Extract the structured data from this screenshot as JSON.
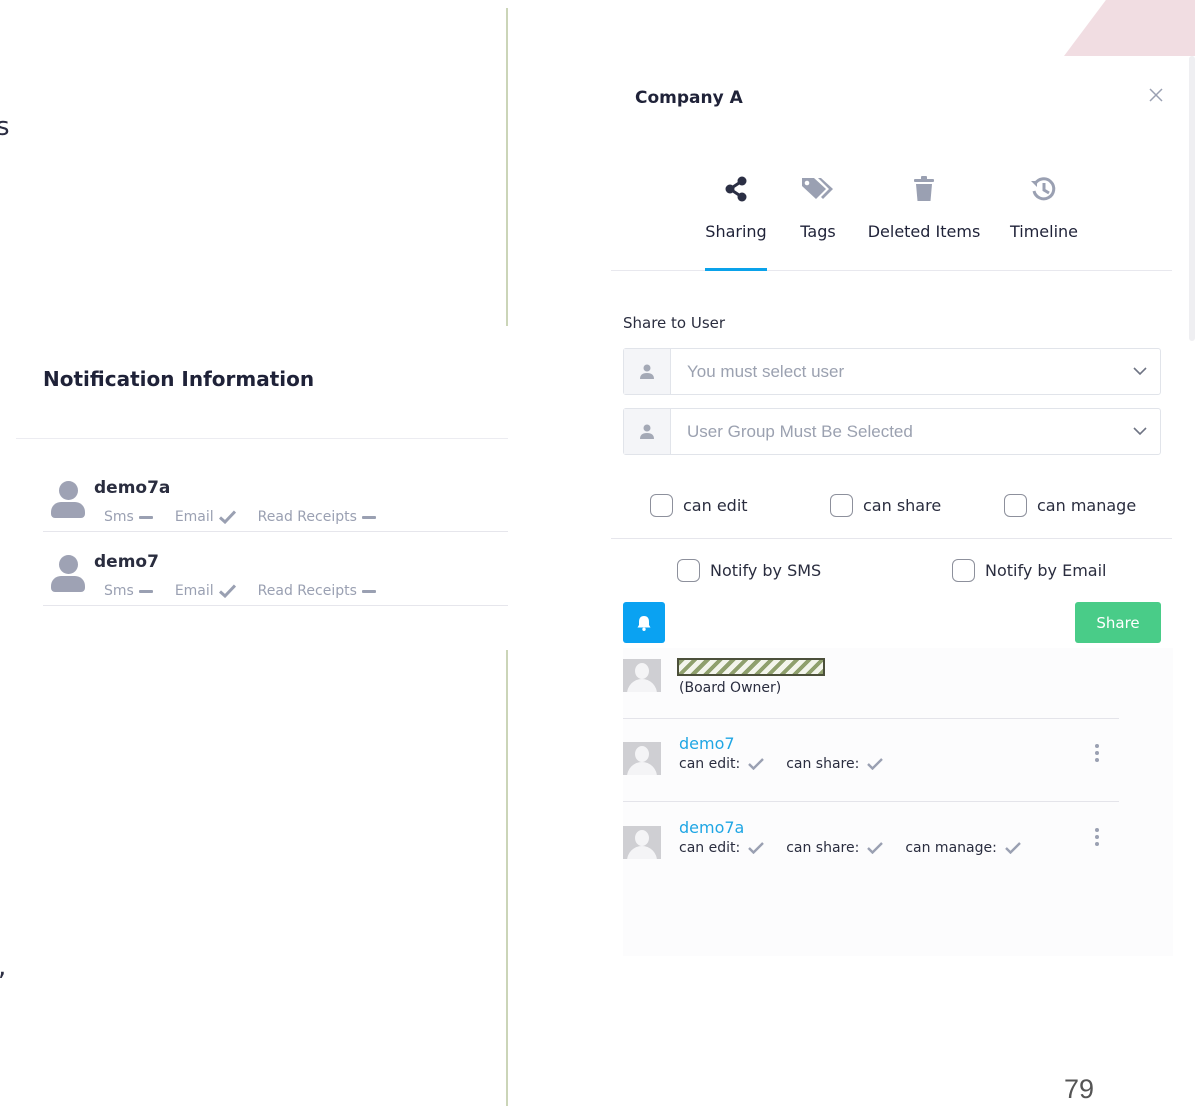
{
  "left_panel": {
    "stray_top": "s",
    "stray_bottom": ",",
    "title": "Notification Information",
    "recipients": [
      {
        "name": "demo7a",
        "sms_label": "Sms",
        "sms": "off",
        "email_label": "Email",
        "email": "on",
        "receipts_label": "Read Receipts",
        "receipts": "off"
      },
      {
        "name": "demo7",
        "sms_label": "Sms",
        "sms": "off",
        "email_label": "Email",
        "email": "on",
        "receipts_label": "Read Receipts",
        "receipts": "off"
      }
    ]
  },
  "dialog": {
    "title": "Company A",
    "tabs": [
      {
        "label": "Sharing",
        "icon": "share-icon",
        "active": true
      },
      {
        "label": "Tags",
        "icon": "tags-icon",
        "active": false
      },
      {
        "label": "Deleted Items",
        "icon": "trash-icon",
        "active": false
      },
      {
        "label": "Timeline",
        "icon": "history-icon",
        "active": false
      }
    ],
    "share_to_label": "Share to User",
    "user_select_placeholder": "You must select user",
    "group_select_placeholder": "User Group Must Be Selected",
    "permissions": {
      "can_edit": "can edit",
      "can_share": "can share",
      "can_manage": "can manage"
    },
    "notify": {
      "sms": "Notify by SMS",
      "email": "Notify by Email"
    },
    "share_button": "Share",
    "owner_tag": "(Board Owner)",
    "shared_users": [
      {
        "name": "demo7",
        "perms": [
          {
            "label": "can edit:",
            "value": true
          },
          {
            "label": "can share:",
            "value": true
          }
        ]
      },
      {
        "name": "demo7a",
        "perms": [
          {
            "label": "can edit:",
            "value": true
          },
          {
            "label": "can share:",
            "value": true
          },
          {
            "label": "can manage:",
            "value": true
          }
        ]
      }
    ],
    "colors": {
      "accent": "#0aa2ea",
      "share_button": "#49cc88",
      "link": "#1fa6e4"
    }
  },
  "page_number": "79"
}
